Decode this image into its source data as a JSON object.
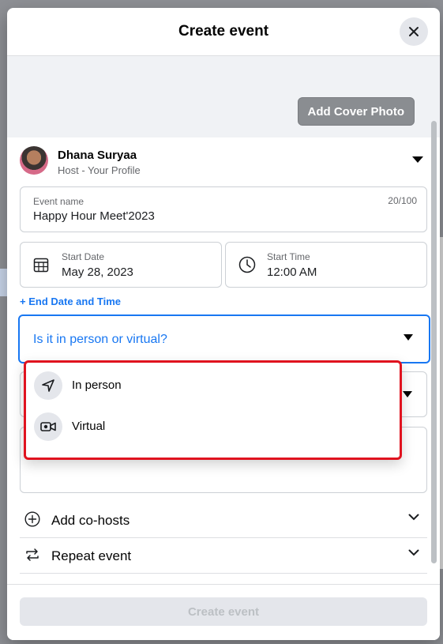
{
  "modal": {
    "title": "Create event",
    "close_icon": "close-icon"
  },
  "cover": {
    "button_label": "Add Cover Photo"
  },
  "host": {
    "name": "Dhana Suryaa",
    "role": "Host - Your Profile"
  },
  "event_name": {
    "label": "Event name",
    "value": "Happy Hour Meet'2023",
    "counter": "20/100"
  },
  "start_date": {
    "label": "Start Date",
    "value": "May 28, 2023",
    "icon": "calendar-icon"
  },
  "start_time": {
    "label": "Start Time",
    "value": "12:00 AM",
    "icon": "clock-icon"
  },
  "end_date_link": "+ End Date and Time",
  "location_type": {
    "placeholder": "Is it in person or virtual?",
    "options": [
      {
        "label": "In person",
        "icon": "navigation-arrow-icon"
      },
      {
        "label": "Virtual",
        "icon": "video-camera-icon"
      }
    ]
  },
  "sections": [
    {
      "label": "Add co-hosts",
      "icon": "plus-circle-icon"
    },
    {
      "label": "Repeat event",
      "icon": "repeat-icon"
    }
  ],
  "footer": {
    "submit_label": "Create event"
  },
  "colors": {
    "accent": "#1877f2",
    "highlight": "#e0131f",
    "disabled": "#e4e6eb"
  }
}
